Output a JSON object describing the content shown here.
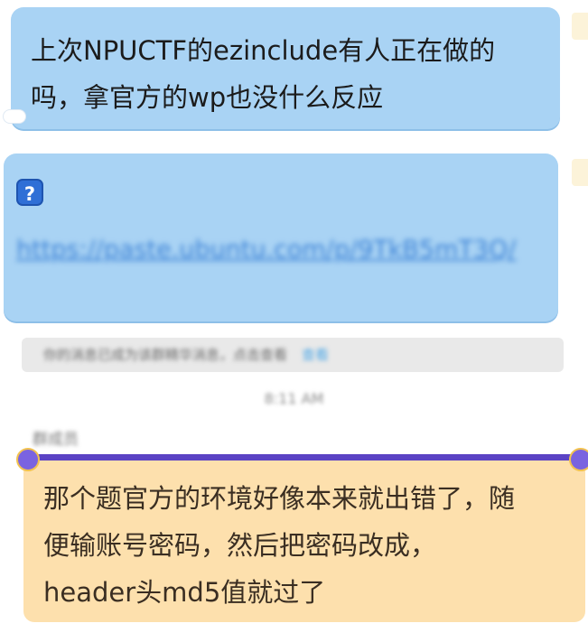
{
  "messages": [
    {
      "text_line1": "上次NPUCTF的ezinclude有人正在做的",
      "text_line2": "吗，拿官方的wp也没什么反应"
    },
    {
      "link_text": "https://paste.ubuntu.com/p/9TkB5mT3Q/",
      "icon": "question-shield-icon"
    }
  ],
  "notice": {
    "text": "你的消息已成为该群精华消息，点击查看",
    "action": "查看"
  },
  "timestamp": "8:11 AM",
  "reply": {
    "nickname": "群成员",
    "line1": "那个题官方的环境好像本来就出错了，随",
    "line2": "便输账号密码，然后把密码改成，",
    "line3": "header头md5值就过了"
  },
  "colors": {
    "bubble_blue": "#a9d3f4",
    "bubble_orange": "#fde0ad",
    "accent_purple": "#5b43c4",
    "link_blue": "#3c82d6"
  }
}
